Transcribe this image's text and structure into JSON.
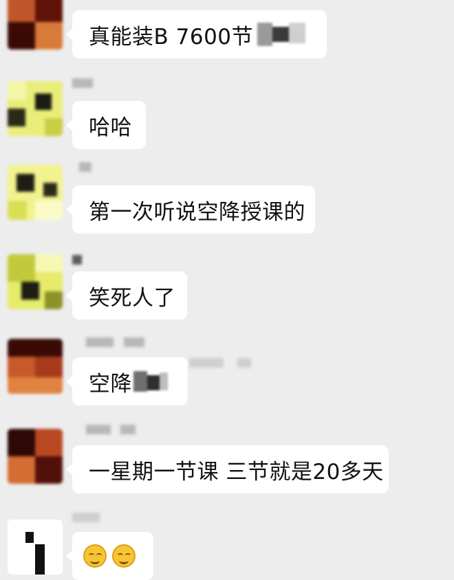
{
  "chat": {
    "messages": [
      {
        "text": "真能装B 7600节"
      },
      {
        "text": "哈哈"
      },
      {
        "text": "第一次听说空降授课的"
      },
      {
        "text": "笑死人了"
      },
      {
        "text": "空降"
      },
      {
        "text": "一星期一节课 三节就是20多天"
      },
      {
        "text": ""
      }
    ]
  },
  "colors": {
    "background": "#ededed",
    "bubble": "#ffffff",
    "text": "#111111",
    "censor_block": "#b8b8b8"
  },
  "icons": {
    "emoji": "grinning-face-icon"
  }
}
